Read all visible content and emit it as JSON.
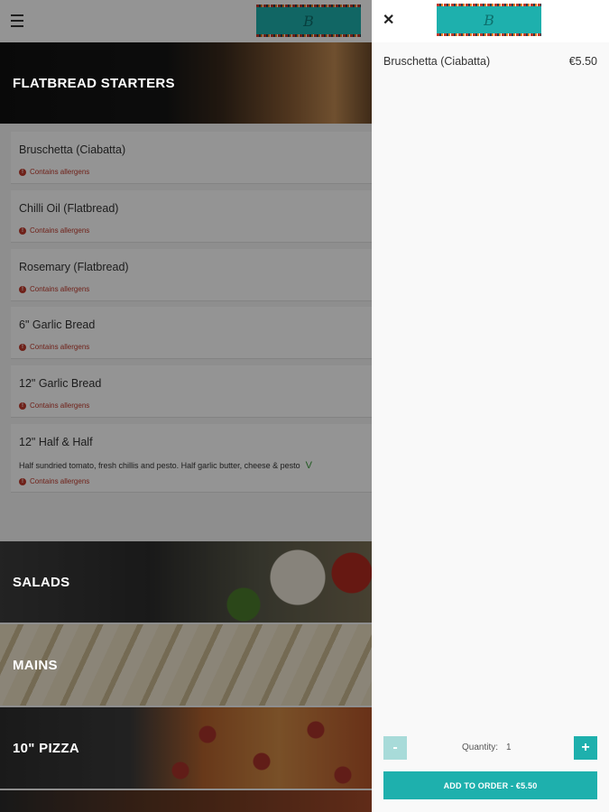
{
  "menu": {
    "sections": [
      {
        "label": "FLATBREAD STARTERS"
      },
      {
        "label": "SALADS"
      },
      {
        "label": "MAINS"
      },
      {
        "label": "10\" PIZZA"
      }
    ],
    "items": [
      {
        "name": "Bruschetta (Ciabatta)",
        "allergen": "Contains allergens"
      },
      {
        "name": "Chilli Oil (Flatbread)",
        "allergen": "Contains allergens"
      },
      {
        "name": "Rosemary (Flatbread)",
        "allergen": "Contains allergens"
      },
      {
        "name": "6\" Garlic Bread",
        "allergen": "Contains allergens"
      },
      {
        "name": "12\" Garlic Bread",
        "allergen": "Contains allergens"
      },
      {
        "name": "12\" Half & Half",
        "description": "Half sundried tomato, fresh chillis and pesto. Half garlic butter, cheese & pesto",
        "vegetarian_mark": "V",
        "allergen": "Contains allergens"
      }
    ]
  },
  "panel": {
    "selected_item": "Bruschetta (Ciabatta)",
    "selected_price": "€5.50",
    "quantity_label": "Quantity:",
    "quantity_value": "1",
    "minus_label": "-",
    "plus_label": "+",
    "add_button_label": "ADD TO ORDER  -  €5.50"
  },
  "icons": {
    "menu": "hamburger-icon",
    "close": "close-icon",
    "allergen": "alert-icon",
    "vegetarian": "leaf-icon"
  },
  "colors": {
    "accent": "#1eb0ad",
    "allergen": "#c0392b",
    "vegetarian": "#3a9a3a"
  }
}
